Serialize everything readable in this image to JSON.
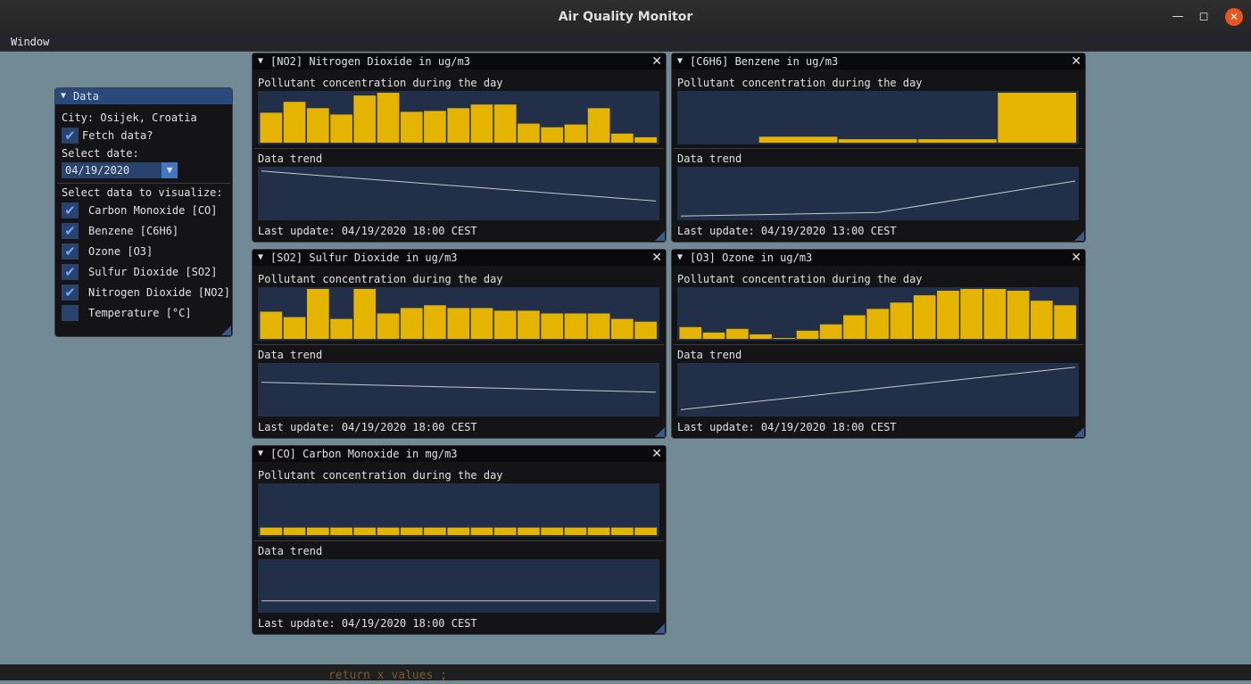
{
  "window": {
    "title": "Air Quality Monitor"
  },
  "menubar": {
    "items": [
      "Window"
    ]
  },
  "background_text": "return x values ;",
  "data_panel": {
    "title": "Data",
    "city": "City: Osijek, Croatia",
    "fetch_label": "Fetch data?",
    "fetch_checked": true,
    "select_date_label": "Select date:",
    "date_value": "04/19/2020",
    "select_data_label": "Select data to visualize:",
    "options": [
      {
        "label": "Carbon Monoxide [CO]",
        "checked": true
      },
      {
        "label": "Benzene [C6H6]",
        "checked": true
      },
      {
        "label": "Ozone [O3]",
        "checked": true
      },
      {
        "label": "Sulfur Dioxide [SO2]",
        "checked": true
      },
      {
        "label": "Nitrogen Dioxide [NO2]",
        "checked": true
      },
      {
        "label": "Temperature [°C]",
        "checked": false
      }
    ]
  },
  "pollutant_windows": [
    {
      "title": "[NO2] Nitrogen Dioxide in ug/m3",
      "bar_label": "Pollutant concentration during the day",
      "trend_label": "Data trend",
      "last_update": "Last update: 04/19/2020 18:00 CEST",
      "chart_data": {
        "type": "bar",
        "values": [
          33,
          45,
          38,
          31,
          52,
          55,
          34,
          35,
          38,
          42,
          42,
          21,
          17,
          20,
          38,
          10,
          6
        ],
        "ymax": 55
      },
      "trend": {
        "type": "line",
        "values": [
          0.95,
          0.35
        ]
      }
    },
    {
      "title": "[C6H6] Benzene in ug/m3",
      "bar_label": "Pollutant concentration during the day",
      "trend_label": "Data trend",
      "last_update": "Last update: 04/19/2020 13:00 CEST",
      "chart_data": {
        "type": "bar",
        "values": [
          0,
          0.12,
          0.07,
          0.07,
          1
        ],
        "ymax": 1
      },
      "trend": {
        "type": "line",
        "values": [
          0.05,
          0.12,
          0.75
        ]
      }
    },
    {
      "title": "[SO2] Sulfur Dioxide in ug/m3",
      "bar_label": "Pollutant concentration during the day",
      "trend_label": "Data trend",
      "last_update": "Last update: 04/19/2020 18:00 CEST",
      "chart_data": {
        "type": "bar",
        "values": [
          30,
          24,
          55,
          22,
          55,
          28,
          34,
          37,
          34,
          34,
          31,
          31,
          28,
          28,
          28,
          22,
          19
        ],
        "ymax": 55
      },
      "trend": {
        "type": "line",
        "values": [
          0.65,
          0.45
        ]
      }
    },
    {
      "title": "[O3] Ozone in ug/m3",
      "bar_label": "Pollutant concentration during the day",
      "trend_label": "Data trend",
      "last_update": "Last update: 04/19/2020 18:00 CEST",
      "chart_data": {
        "type": "bar",
        "values": [
          13,
          7,
          11,
          5,
          1,
          9,
          16,
          26,
          33,
          40,
          48,
          53,
          55,
          55,
          53,
          42,
          37
        ],
        "ymax": 55
      },
      "trend": {
        "type": "line",
        "values": [
          0.1,
          0.95
        ]
      }
    },
    {
      "title": "[CO] Carbon Monoxide in mg/m3",
      "bar_label": "Pollutant concentration during the day",
      "trend_label": "Data trend",
      "last_update": "Last update: 04/19/2020 18:00 CEST",
      "chart_data": {
        "type": "bar",
        "values": [
          0.3,
          0.3,
          0.3,
          0.3,
          0.3,
          0.3,
          0.3,
          0.3,
          0.3,
          0.3,
          0.3,
          0.3,
          0.3,
          0.3,
          0.3,
          0.3,
          0.3
        ],
        "ymax": 2
      },
      "trend": {
        "type": "line",
        "values": [
          0.2,
          0.2
        ]
      }
    }
  ]
}
